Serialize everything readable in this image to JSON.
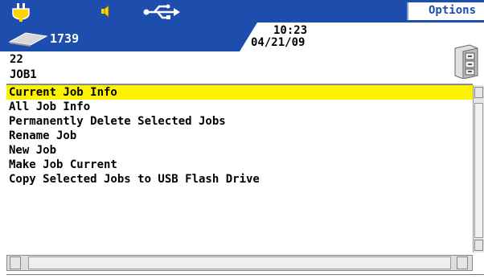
{
  "status_bar": {
    "options_label": "Options",
    "drive_count": "1739",
    "time": "10:23",
    "date": "04/21/09",
    "accent_color": "#1d4eae"
  },
  "icons": {
    "power": "power-plug-icon",
    "speaker": "speaker-icon",
    "usb": "usb-icon",
    "drive": "drive-icon",
    "cabinet": "file-cabinet-icon"
  },
  "job": {
    "number": "22",
    "name": "JOB1"
  },
  "menu": {
    "selected_index": 0,
    "highlight_color": "#fdf200",
    "items": [
      "Current Job Info",
      "All Job Info",
      "Permanently Delete Selected Jobs",
      "Rename Job",
      "New Job",
      "Make Job Current",
      "Copy Selected Jobs to USB Flash Drive"
    ]
  }
}
